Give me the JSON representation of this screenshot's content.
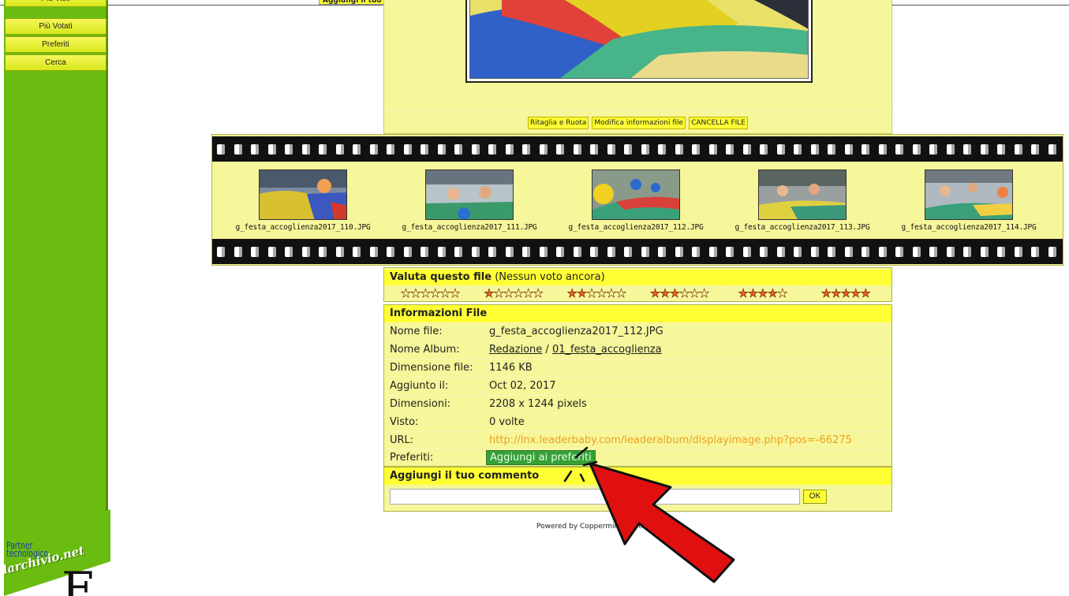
{
  "top_bar": {
    "cut_label": "Aggiungi il tuo commento"
  },
  "sidebar": {
    "items": [
      {
        "label": "Più Visti"
      },
      {
        "label": "Più Votati"
      },
      {
        "label": "Preferiti"
      },
      {
        "label": "Cerca"
      }
    ],
    "partner_line1": "Partner",
    "partner_line2": "tecnologico",
    "brand": "larchivio.net"
  },
  "image_panel": {
    "actions": [
      {
        "label": "Ritaglia e Ruota"
      },
      {
        "label": "Modifica informazioni file"
      },
      {
        "label": "CANCELLA FILE"
      }
    ]
  },
  "filmstrip": {
    "thumbnails": [
      {
        "name": "g_festa_accoglienza2017_110.JPG"
      },
      {
        "name": "g_festa_accoglienza2017_111.JPG"
      },
      {
        "name": "g_festa_accoglienza2017_112.JPG"
      },
      {
        "name": "g_festa_accoglienza2017_113.JPG"
      },
      {
        "name": "g_festa_accoglienza2017_114.JPG"
      }
    ]
  },
  "rating": {
    "title": "Valuta questo file",
    "status": "(Nessun voto ancora)",
    "options": [
      {
        "filled": 0,
        "total": 6
      },
      {
        "filled": 1,
        "total": 6
      },
      {
        "filled": 2,
        "total": 6
      },
      {
        "filled": 3,
        "total": 6
      },
      {
        "filled": 4,
        "total": 5
      },
      {
        "filled": 5,
        "total": 5
      }
    ]
  },
  "file_info": {
    "title": "Informazioni File",
    "rows": {
      "nome_file": {
        "label": "Nome file:",
        "value": "g_festa_accoglienza2017_112.JPG"
      },
      "nome_album": {
        "label": "Nome Album:",
        "album": "Redazione",
        "separator": " / ",
        "subalbum": "01_festa_accoglienza"
      },
      "dimensione": {
        "label": "Dimensione file:",
        "value": "1146 KB"
      },
      "aggiunto": {
        "label": "Aggiunto il:",
        "value": "Oct 02, 2017"
      },
      "dimensioni": {
        "label": "Dimensioni:",
        "value": "2208 x 1244 pixels"
      },
      "visto": {
        "label": "Visto:",
        "value": "0 volte"
      },
      "url": {
        "label": "URL:",
        "value": "http://lnx.leaderbaby.com/leaderalbum/displayimage.php?pos=-66275"
      },
      "preferiti": {
        "label": "Preferiti:",
        "button": "Aggiungi ai preferiti"
      }
    }
  },
  "comment": {
    "title": "Aggiungi il tuo commento",
    "input_value": "",
    "ok_label": "OK"
  },
  "footer": {
    "powered": "Powered by Coppermine Photo Gallery"
  },
  "bottom_text": {
    "big_letter": "E",
    "tail": ""
  },
  "colors": {
    "sidebar_green": "#6abc10",
    "panel_yellow": "#f6f69a",
    "header_yellow": "#ffff33",
    "url_orange": "#f0a020",
    "arrow_red": "#e01010"
  }
}
